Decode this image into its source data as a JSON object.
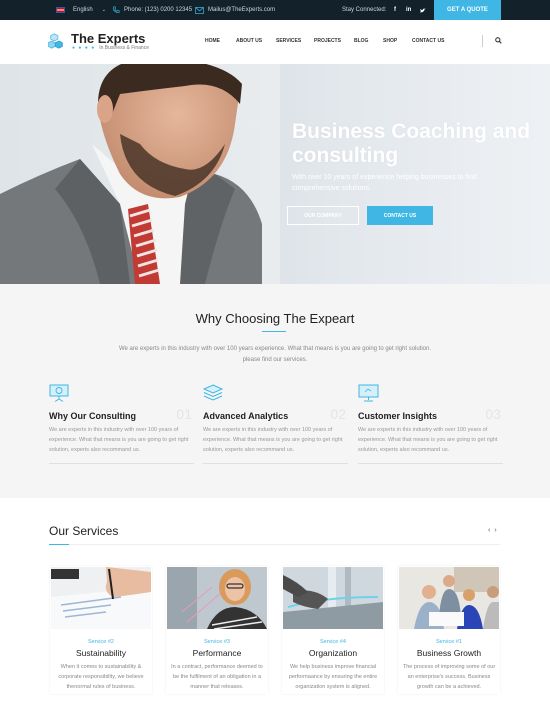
{
  "topbar": {
    "language": "English",
    "phone": "Phone: (123) 0200 12345",
    "email": "Mailus@TheExperts.com",
    "stay_connected": "Stay Connected:",
    "social": [
      "f",
      "in",
      "t"
    ],
    "quote_button": "GET A QUOTE"
  },
  "header": {
    "logo_title": "The Experts",
    "logo_dots": "● ● ● ●",
    "logo_subtitle": "In Business & Finance",
    "nav": [
      "HOME",
      "ABOUT US",
      "SERVICES",
      "PROJECTS",
      "BLOG",
      "SHOP",
      "CONTACT US"
    ]
  },
  "hero": {
    "title": "Business Coaching and consulting",
    "subtitle": "With over 10 years of experience helping businesses to find comprehensive solutions.",
    "btn_company": "OUR COMPANY",
    "btn_contact": "CONTACT US"
  },
  "why": {
    "title": "Why Choosing The Expeart",
    "subtitle": "We are experts in this industry with over 100 years experience. What that means is you are going to get right solution. please find our services.",
    "features": [
      {
        "icon": "presentation-board-icon",
        "title": "Why Our Consulting",
        "num": "01",
        "text": "We are experts in this industry with over 100 years of experience. What that means is you are going to get right solution, experts also recommand us."
      },
      {
        "icon": "layers-icon",
        "title": "Advanced Analytics",
        "num": "02",
        "text": "We are experts in this industry with over 100 years of experience. What that means is you are going to get right solution, experts also recommand us."
      },
      {
        "icon": "monitor-icon",
        "title": "Customer Insights",
        "num": "03",
        "text": "We are experts in this industry with over 100 years of experience. What that means is you are going to get right solution, experts also recommand us."
      }
    ]
  },
  "services": {
    "title": "Our Services",
    "prev": "‹",
    "next": "›",
    "cards": [
      {
        "tag": "Service #2",
        "title": "Sustainability",
        "text": "When it comes to sustainability & corporate responsibility, we believe thenormal rules of business."
      },
      {
        "tag": "Service #3",
        "title": "Performance",
        "text": "In a contract, performance deemed to be the fulfilment of an obligation in a manner that releases."
      },
      {
        "tag": "Service #4",
        "title": "Organization",
        "text": "We help business improve financial performaance by ensuring the entire organization system is aligned."
      },
      {
        "tag": "Service #1",
        "title": "Business Growth",
        "text": "The process of improving some of our an enterprise's success. Business growth can be a achieved."
      }
    ]
  },
  "colors": {
    "accent": "#3fb6e4",
    "topbar": "#13212b"
  }
}
